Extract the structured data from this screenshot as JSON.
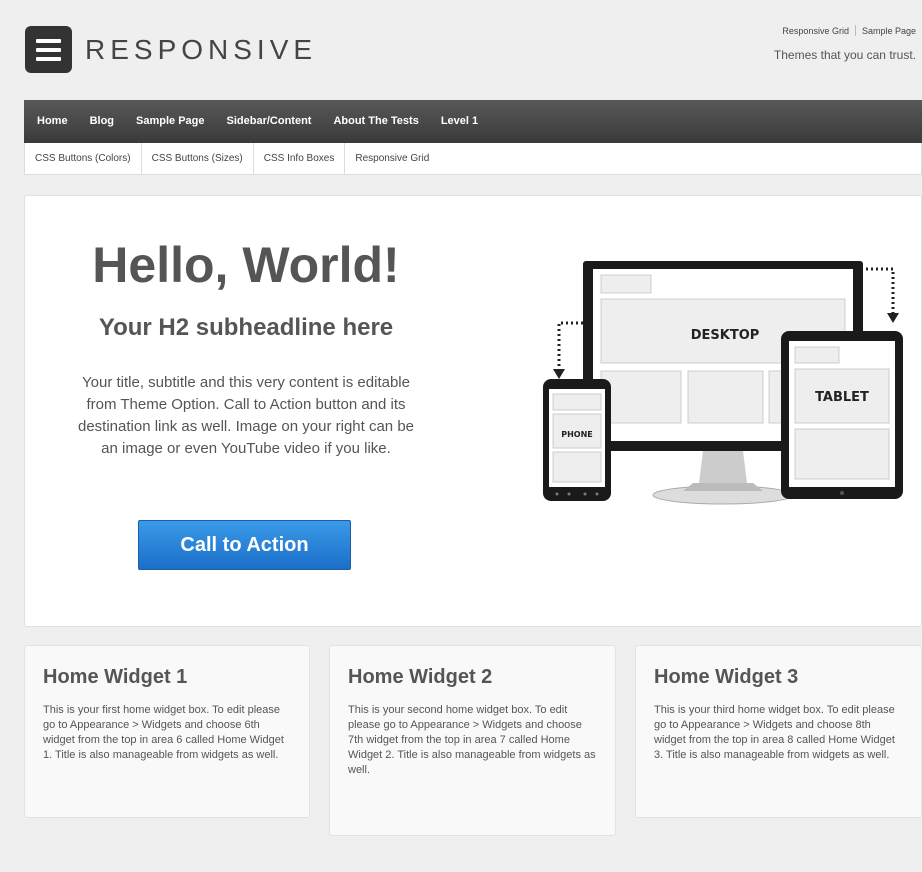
{
  "header": {
    "logo_text": "RESPONSIVE",
    "top_links": [
      "Responsive Grid",
      "Sample Page"
    ],
    "tagline": "Themes that you can trust."
  },
  "menu": [
    "Home",
    "Blog",
    "Sample Page",
    "Sidebar/Content",
    "About The Tests",
    "Level 1"
  ],
  "submenu": [
    "CSS Buttons (Colors)",
    "CSS Buttons (Sizes)",
    "CSS Info Boxes",
    "Responsive Grid"
  ],
  "featured": {
    "headline": "Hello, World!",
    "subheadline": "Your H2 subheadline here",
    "content": "Your title, subtitle and this very content is editable from Theme Option. Call to Action button and its destination link as well. Image on your right can be an image or even YouTube video if you like.",
    "cta_label": "Call to Action",
    "device_labels": {
      "desktop": "DESKTOP",
      "tablet": "TABLET",
      "phone": "PHONE"
    }
  },
  "widgets": [
    {
      "title": "Home Widget 1",
      "text": "This is your first home widget box. To edit please go to Appearance > Widgets and choose 6th widget from the top in area 6 called Home Widget 1. Title is also manageable from widgets as well."
    },
    {
      "title": "Home Widget 2",
      "text": "This is your second home widget box. To edit please go to Appearance > Widgets and choose 7th widget from the top in area 7 called Home Widget 2. Title is also manageable from widgets as well."
    },
    {
      "title": "Home Widget 3",
      "text": "This is your third home widget box. To edit please go to Appearance > Widgets and choose 8th widget from the top in area 8 called Home Widget 3. Title is also manageable from widgets as well."
    }
  ],
  "colors": {
    "menu_bg": "#444444",
    "cta_blue": "#2a84d9",
    "page_bg": "#efefef"
  }
}
